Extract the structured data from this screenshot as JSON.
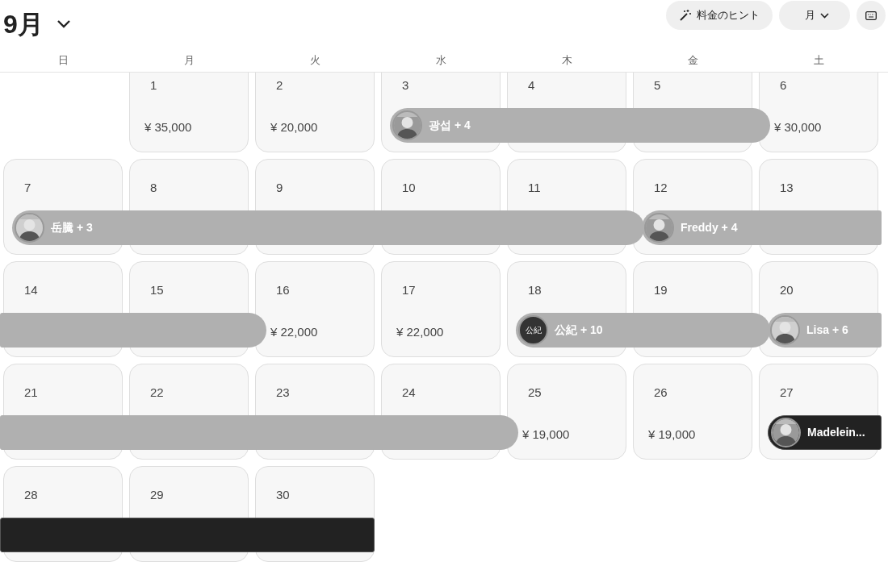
{
  "header": {
    "month": "9月",
    "buttons": [
      {
        "kind": "hint",
        "label": "料金のヒント"
      },
      {
        "kind": "view",
        "label": "月"
      },
      {
        "kind": "keyboard"
      }
    ]
  },
  "weekdays": [
    {
      "label": "日"
    },
    {
      "label": "月"
    },
    {
      "label": "火"
    },
    {
      "label": "水"
    },
    {
      "label": "木"
    },
    {
      "label": "金"
    },
    {
      "label": "土"
    }
  ],
  "weeks": [
    {
      "days": [
        {
          "kind": "empty"
        },
        {
          "kind": "free",
          "day": "1",
          "price": "¥ 35,000"
        },
        {
          "kind": "free",
          "day": "2",
          "price": "¥ 20,000"
        },
        {
          "kind": "checkin",
          "day": "3",
          "booking": {
            "label": "광섭 + 4",
            "highlighted": false
          }
        },
        {
          "kind": "night",
          "day": "4"
        },
        {
          "kind": "night",
          "day": "5"
        },
        {
          "kind": "checkout",
          "day": "6",
          "price": "¥ 30,000"
        }
      ]
    },
    {
      "days": [
        {
          "kind": "checkin",
          "day": "7",
          "booking": {
            "label": "岳騰 + 3",
            "highlighted": false
          }
        },
        {
          "kind": "night",
          "day": "8"
        },
        {
          "kind": "night",
          "day": "9"
        },
        {
          "kind": "night",
          "day": "10"
        },
        {
          "kind": "night",
          "day": "11"
        },
        {
          "kind": "turnover",
          "day": "12",
          "booking": {
            "label": "Freddy + 4",
            "highlighted": false
          }
        },
        {
          "kind": "night",
          "day": "13"
        }
      ]
    },
    {
      "continued": {
        "highlighted": false
      },
      "days": [
        {
          "kind": "night",
          "day": "14"
        },
        {
          "kind": "night",
          "day": "15"
        },
        {
          "kind": "checkout",
          "day": "16",
          "price": "¥ 22,000"
        },
        {
          "kind": "free",
          "day": "17",
          "price": "¥ 22,000"
        },
        {
          "kind": "checkin",
          "day": "18",
          "booking": {
            "label": "公紀 + 10",
            "avatar": {
              "kind": "initials",
              "text": "公紀"
            },
            "highlighted": false
          }
        },
        {
          "kind": "night",
          "day": "19"
        },
        {
          "kind": "turnover",
          "day": "20",
          "booking": {
            "label": "Lisa + 6",
            "highlighted": false
          }
        }
      ]
    },
    {
      "continued": {
        "highlighted": false
      },
      "days": [
        {
          "kind": "night",
          "day": "21"
        },
        {
          "kind": "night",
          "day": "22"
        },
        {
          "kind": "night",
          "day": "23"
        },
        {
          "kind": "night",
          "day": "24"
        },
        {
          "kind": "checkout",
          "day": "25",
          "price": "¥ 19,000"
        },
        {
          "kind": "free",
          "day": "26",
          "price": "¥ 19,000"
        },
        {
          "kind": "checkin",
          "day": "27",
          "booking": {
            "label": "Madelein...",
            "highlighted": true
          }
        }
      ]
    },
    {
      "continued": {
        "highlighted": true
      },
      "days": [
        {
          "kind": "night",
          "day": "28"
        },
        {
          "kind": "night",
          "day": "29"
        },
        {
          "kind": "night",
          "day": "30"
        }
      ]
    }
  ]
}
